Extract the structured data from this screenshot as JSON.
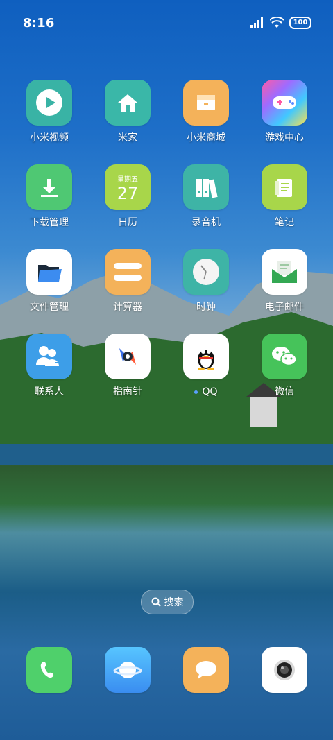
{
  "status": {
    "time": "8:16",
    "battery": "100"
  },
  "apps": [
    {
      "label": "小米视频"
    },
    {
      "label": "米家"
    },
    {
      "label": "小米商城"
    },
    {
      "label": "游戏中心"
    },
    {
      "label": "下载管理"
    },
    {
      "label": "日历",
      "weekday": "星期五",
      "day": "27"
    },
    {
      "label": "录音机"
    },
    {
      "label": "笔记"
    },
    {
      "label": "文件管理"
    },
    {
      "label": "计算器"
    },
    {
      "label": "时钟"
    },
    {
      "label": "电子邮件"
    },
    {
      "label": "联系人"
    },
    {
      "label": "指南针"
    },
    {
      "label": "QQ"
    },
    {
      "label": "微信"
    }
  ],
  "search": {
    "label": "搜索"
  }
}
